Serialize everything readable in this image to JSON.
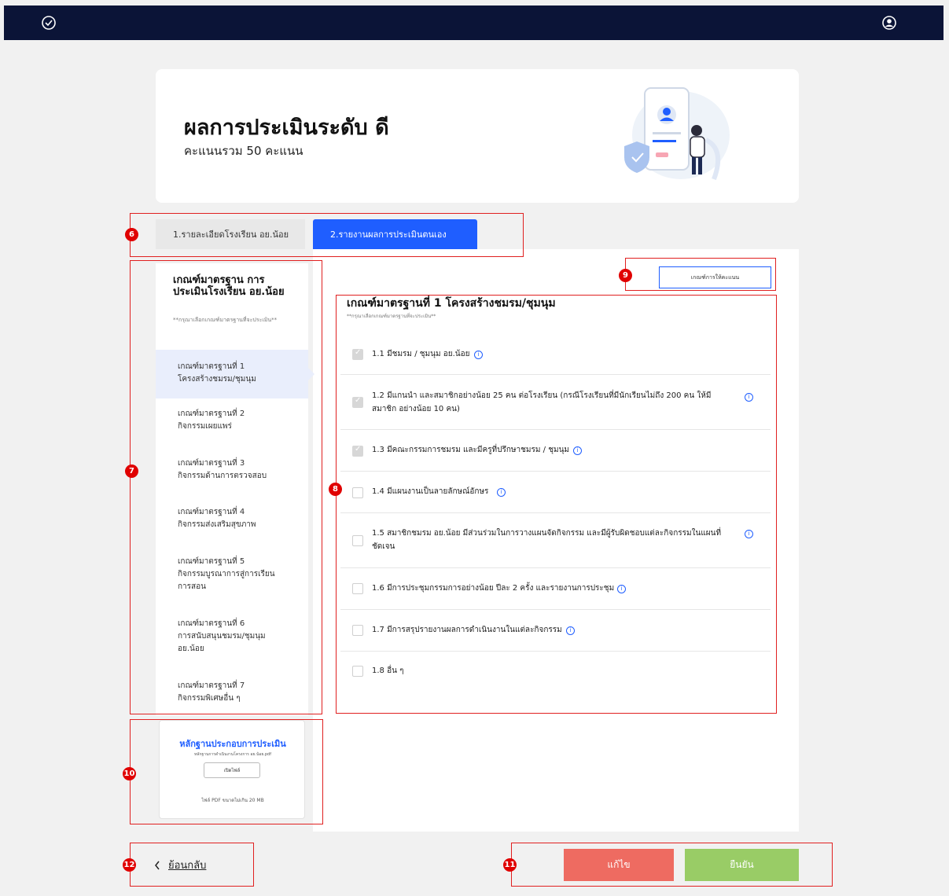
{
  "topbar": {
    "logo_icon": "check-circle-icon",
    "user_icon": "user-circle-icon"
  },
  "header": {
    "title": "ผลการประเมินระดับ ดี",
    "subtitle": "คะแนนรวม 50 คะแนน"
  },
  "tabs": [
    {
      "label": "1.รายละเอียดโรงเรียน อย.น้อย"
    },
    {
      "label": "2.รายงานผลการประเมินตนเอง"
    }
  ],
  "sidebar": {
    "title": "เกณฑ์มาตรฐาน การประเมินโรงเรียน อย.น้อย",
    "hint": "**กรุณาเลือกเกณฑ์มาตรฐานที่จะประเมิน**",
    "items": [
      {
        "line1": "เกณฑ์มาตรฐานที่ 1",
        "line2": "โครงสร้างชมรม/ชุมนุม",
        "line3": ""
      },
      {
        "line1": "เกณฑ์มาตรฐานที่ 2",
        "line2": "กิจกรรมเผยแพร่",
        "line3": ""
      },
      {
        "line1": "เกณฑ์มาตรฐานที่ 3",
        "line2": "กิจกรรมด้านการตรวจสอบ",
        "line3": ""
      },
      {
        "line1": "เกณฑ์มาตรฐานที่ 4",
        "line2": "กิจกรรมส่งเสริมสุขภาพ",
        "line3": ""
      },
      {
        "line1": "เกณฑ์มาตรฐานที่ 5",
        "line2": "กิจกรรมบูรณาการสู่การเรียน",
        "line3": "การสอน"
      },
      {
        "line1": "เกณฑ์มาตรฐานที่ 6",
        "line2": "การสนับสนุนชมรม/ชุมนุม",
        "line3": "อย.น้อย"
      },
      {
        "line1": "เกณฑ์มาตรฐานที่ 7",
        "line2": "กิจกรรมพิเศษอื่น ๆ",
        "line3": ""
      }
    ]
  },
  "criteria_button": "เกณฑ์การให้คะแนน",
  "criteria": {
    "title": "เกณฑ์มาตรฐานที่ 1 โครงสร้างชมรม/ชุมนุม",
    "hint": "**กรุณาเลือกเกณฑ์มาตรฐานที่จะประเมิน**",
    "items": [
      {
        "text": "1.1 มีชมรม / ชุมนุม อย.น้อย",
        "checked": true
      },
      {
        "text": "1.2 มีแกนนำ และสมาชิกอย่างน้อย 25 คน ต่อโรงเรียน (กรณีโรงเรียนที่มีนักเรียนไม่ถึง 200 คน ให้มีสมาชิก อย่างน้อย 10 คน)",
        "checked": true
      },
      {
        "text": "1.3 มีคณะกรรมการชมรม และมีครูที่ปรึกษาชมรม / ชุมนุม",
        "checked": true
      },
      {
        "text": "1.4 มีแผนงานเป็นลายลักษณ์อักษร",
        "checked": false
      },
      {
        "text": "1.5 สมาชิกชมรม อย.น้อย มีส่วนร่วมในการวางแผนจัดกิจกรรม และมีผู้รับผิดชอบแต่ละกิจกรรมในแผนที่ ชัดเจน",
        "checked": false
      },
      {
        "text": "1.6 มีการประชุมกรรมการอย่างน้อย ปีละ 2 ครั้ง และรายงานการประชุม",
        "checked": false
      },
      {
        "text": "1.7 มีการสรุปรายงานผลการดำเนินงานในแต่ละกิจกรรม",
        "checked": false
      },
      {
        "text": "1.8 อื่น ๆ",
        "checked": false
      }
    ],
    "info_symbol": "i"
  },
  "evidence": {
    "title": "หลักฐานประกอบการประเมิน",
    "desc": "หลักฐานการดำเนินงานโครงการ อย.น้อย.pdf",
    "button": "เปิดไฟล์",
    "note": "ไฟล์ PDF ขนาดไม่เกิน 20 MB"
  },
  "footer": {
    "back_label": "ย้อนกลับ",
    "back_icon": "chevron-left-icon",
    "edit_label": "แก้ไข",
    "confirm_label": "ยืนยัน"
  },
  "annotations": [
    "6",
    "7",
    "8",
    "9",
    "10",
    "11",
    "12"
  ]
}
